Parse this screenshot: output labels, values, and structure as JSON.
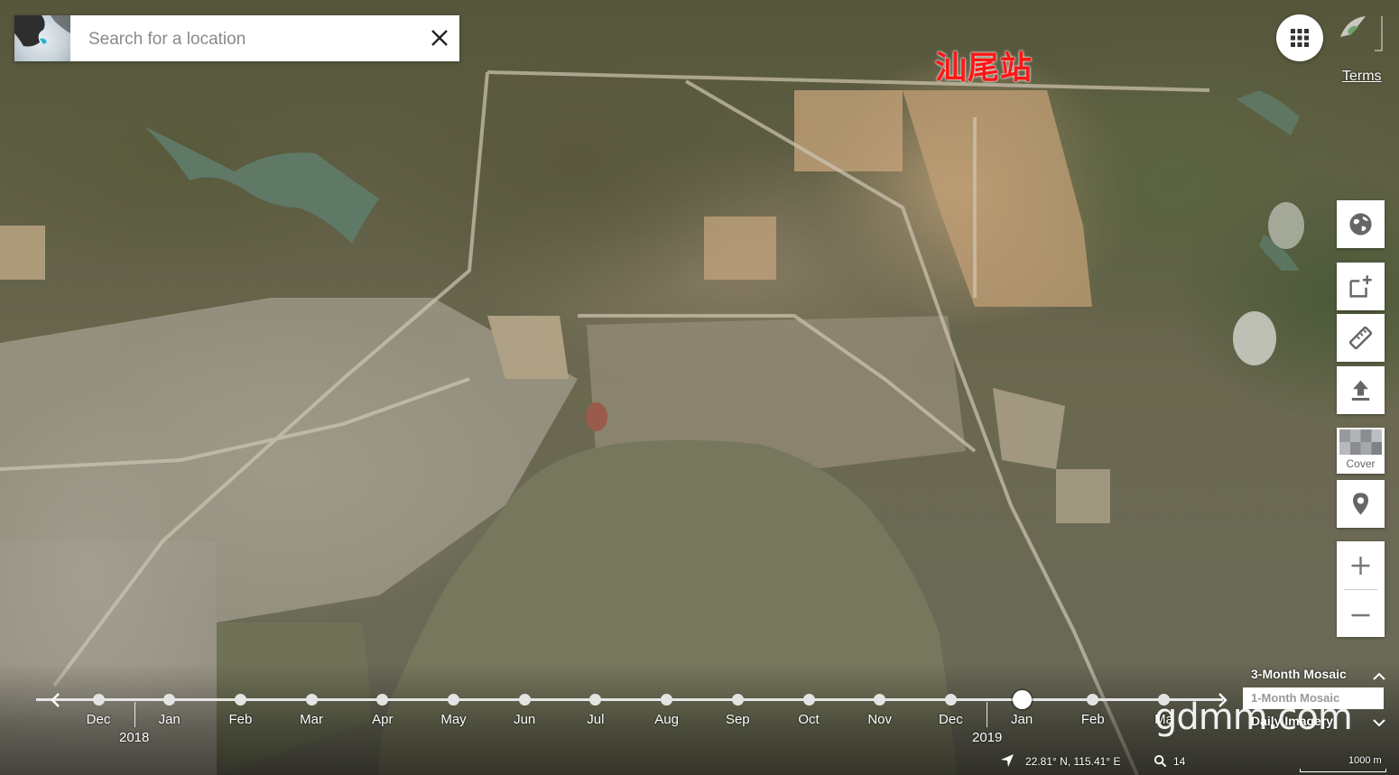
{
  "search": {
    "placeholder": "Search for a location"
  },
  "place_label": "汕尾站",
  "header": {
    "terms": "Terms"
  },
  "toolbar": {
    "globe": "globe-icon",
    "add_layer": "add-layer-icon",
    "ruler": "ruler-icon",
    "upload": "upload-icon",
    "cover_label": "Cover",
    "marker": "location-pin-icon",
    "zoom_in": "+",
    "zoom_out": "−"
  },
  "timeline": {
    "months": [
      "Dec",
      "Jan",
      "Feb",
      "Mar",
      "Apr",
      "May",
      "Jun",
      "Jul",
      "Aug",
      "Sep",
      "Oct",
      "Nov",
      "Dec",
      "Jan",
      "Feb",
      "Ma"
    ],
    "years": [
      "2018",
      "2019"
    ],
    "selected_index": 13
  },
  "mosaic": {
    "title": "3-Month Mosaic",
    "option1": "1-Month Mosaic",
    "option2": "Daily Imagery"
  },
  "watermark": "gdmm.com",
  "status": {
    "coords": "22.81° N, 115.41° E",
    "zoom": "14",
    "scale": "1000 m"
  },
  "colors": {
    "label_red": "#ff1616",
    "water": "#76775c",
    "land_dark": "#55563a"
  }
}
